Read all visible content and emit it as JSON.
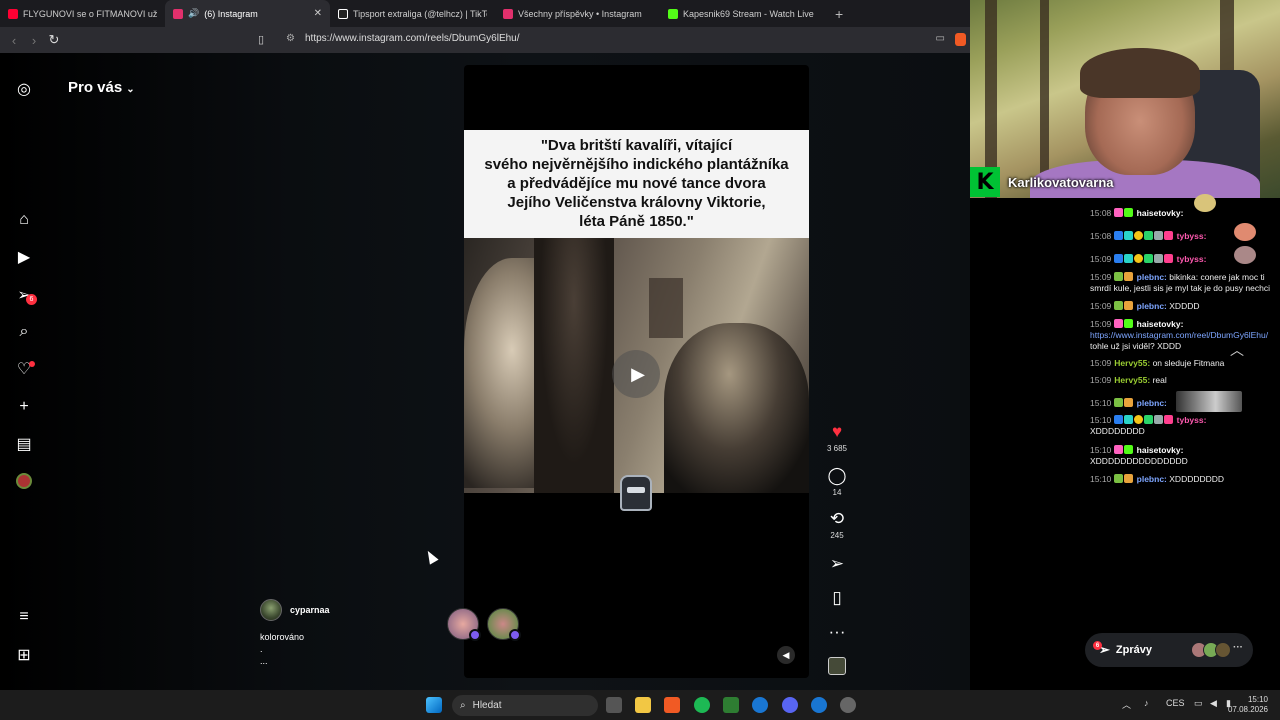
{
  "browser": {
    "tabs": [
      {
        "title": "FLYGUNOVI se o FITMANOVI už i ZDÁ",
        "favicon_color": "#ff0033",
        "active": false
      },
      {
        "title": "(6) Instagram",
        "favicon_color": "#e1306c",
        "active": true
      },
      {
        "title": "Tipsport extraliga (@telhcz) | TikTok",
        "favicon_color": "#ffffff",
        "active": false
      },
      {
        "title": "Všechny příspěvky • Instagram",
        "favicon_color": "#e1306c",
        "active": false
      },
      {
        "title": "Kapesnik69 Stream - Watch Live",
        "favicon_color": "#53fc18",
        "active": false
      }
    ],
    "url": "https://www.instagram.com/reels/DbumGy6lEhu/"
  },
  "instagram": {
    "feed_title": "Pro vás",
    "nav": [
      {
        "name": "instagram-logo-icon",
        "glyph": "◎"
      },
      {
        "name": "home-icon",
        "glyph": "⌂"
      },
      {
        "name": "reels-icon",
        "glyph": "▶"
      },
      {
        "name": "messages-icon",
        "glyph": "➢",
        "badge": "6"
      },
      {
        "name": "search-icon",
        "glyph": "⌕"
      },
      {
        "name": "notifications-icon",
        "glyph": "♡"
      },
      {
        "name": "create-icon",
        "glyph": "+"
      },
      {
        "name": "dashboard-icon",
        "glyph": "▤"
      },
      {
        "name": "profile-icon",
        "glyph": "●"
      },
      {
        "name": "menu-icon",
        "glyph": "≡"
      },
      {
        "name": "also-from-meta-icon",
        "glyph": "⊞"
      }
    ],
    "reel": {
      "caption_lines": [
        "\"Dva britští kavalíři, vítající",
        "svého nejvěrnějšího indického plantážníka",
        "a předvádějíce mu nové tance dvora",
        "Jejího Veličenstva královny Viktorie,",
        "léta Páně 1850.\""
      ],
      "author": "cyparnaa",
      "description_lines": [
        "kolorováno",
        ".",
        "..."
      ],
      "likes": "3 685",
      "comments": "14",
      "reposts": "245"
    },
    "messages_button": {
      "label": "Zprávy",
      "badge": "6"
    }
  },
  "stream_overlay": {
    "streamer": "Karlikovatovarna",
    "chat": [
      {
        "time": "15:08",
        "user": "haisetovky:",
        "user_color": "#ffffff",
        "text": ""
      },
      {
        "time": "15:08",
        "user": "tybyss:",
        "user_color": "#ff5ab0",
        "text": ""
      },
      {
        "time": "15:09",
        "user": "tybyss:",
        "user_color": "#ff5ab0",
        "text": ""
      },
      {
        "time": "15:09",
        "user": "plebnc:",
        "user_color": "#7ea6ff",
        "text": "bikinka: conere jak moc ti smrdí kule, jestli sis je myl tak je do pusy nechci"
      },
      {
        "time": "15:09",
        "user": "plebnc:",
        "user_color": "#7ea6ff",
        "text": "XDDDD"
      },
      {
        "time": "15:09",
        "user": "haisetovky:",
        "user_color": "#ffffff",
        "text": ""
      },
      {
        "time": "",
        "user": "",
        "user_color": "#ffffff",
        "text": "https://www.instagram.com/reel/DbumGy6lEhu/",
        "is_link": true
      },
      {
        "time": "",
        "user": "",
        "user_color": "#ffffff",
        "text": "tohle už jsi viděl? XDDD"
      },
      {
        "time": "15:09",
        "user": "Hervy55:",
        "user_color": "#9acd32",
        "text": "on sleduje Fitmana"
      },
      {
        "time": "15:09",
        "user": "Hervy55:",
        "user_color": "#9acd32",
        "text": "real"
      },
      {
        "time": "15:10",
        "user": "plebnc:",
        "user_color": "#7ea6ff",
        "text": ""
      },
      {
        "time": "15:10",
        "user": "tybyss:",
        "user_color": "#ff5ab0",
        "text": "XDDDDDDDD"
      },
      {
        "time": "15:10",
        "user": "haisetovky:",
        "user_color": "#ffffff",
        "text": "XDDDDDDDDDDDDDDD"
      },
      {
        "time": "15:10",
        "user": "plebnc:",
        "user_color": "#7ea6ff",
        "text": "XDDDDDDDD"
      }
    ]
  },
  "taskbar": {
    "search_placeholder": "Hledat",
    "language": "CES",
    "time": "15:10",
    "date": "07.08.2026"
  }
}
